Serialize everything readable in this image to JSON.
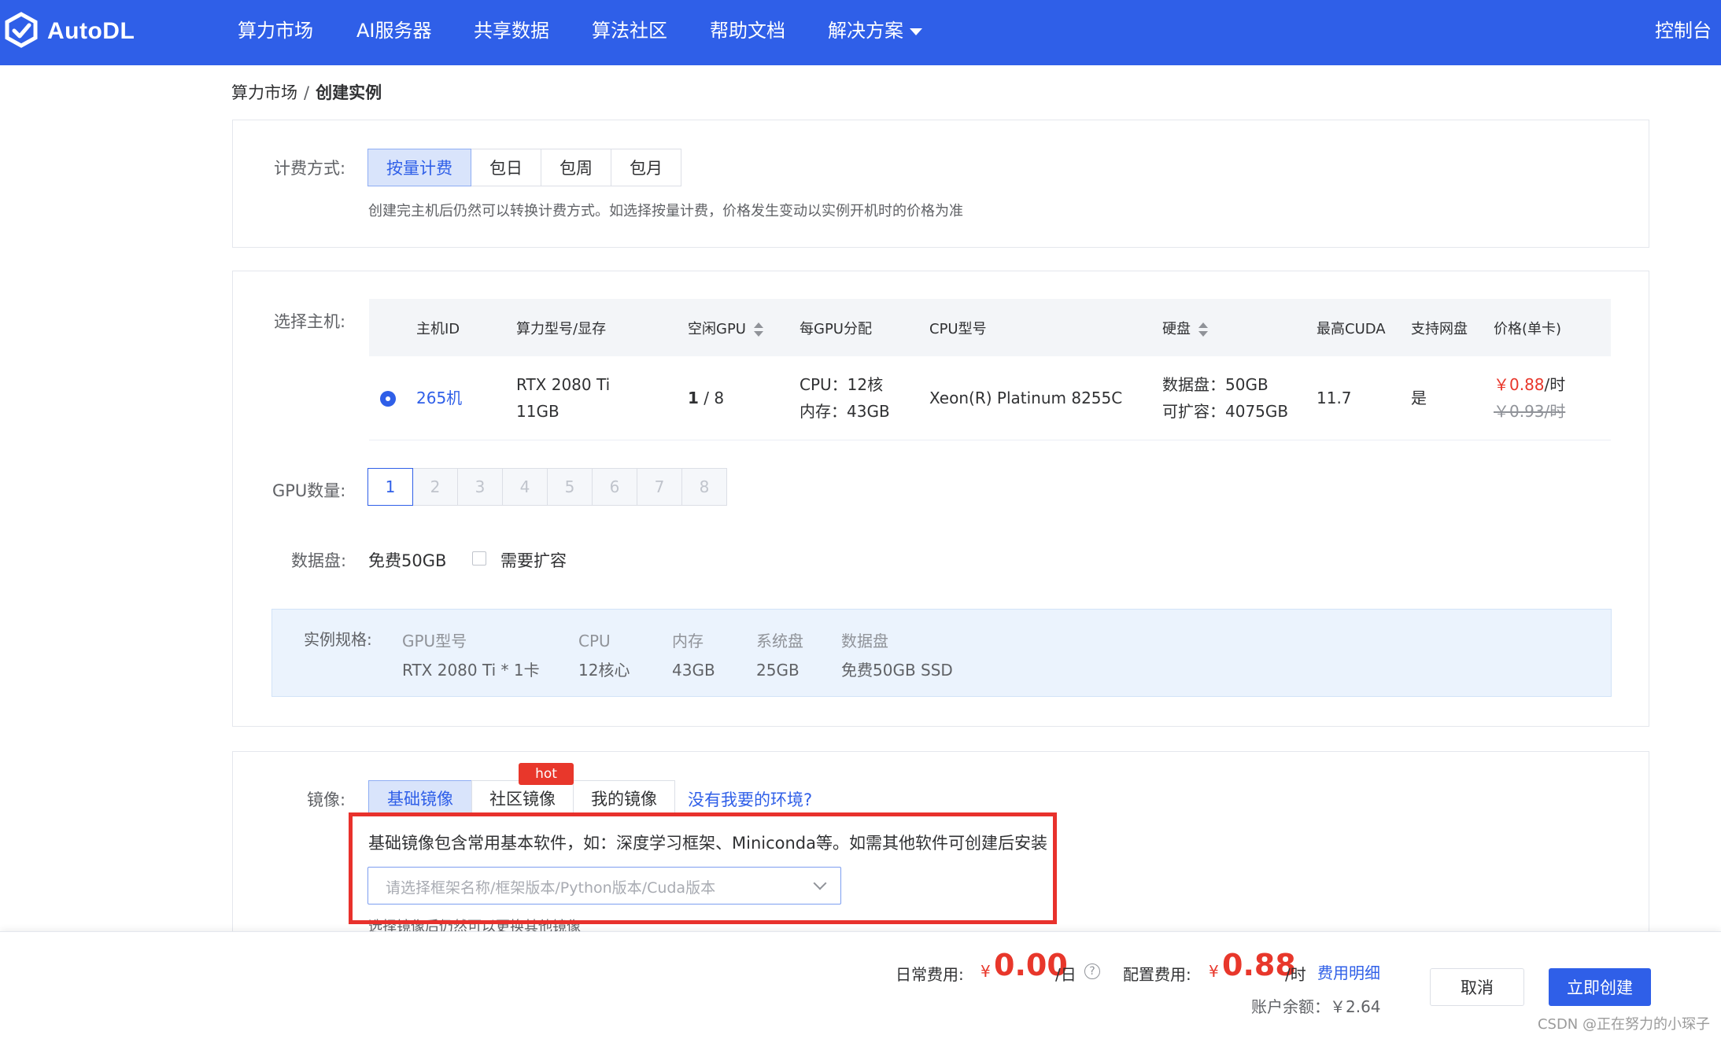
{
  "app": {
    "logo_text": "AutoDL",
    "nav": [
      "算力市场",
      "AI服务器",
      "共享数据",
      "算法社区",
      "帮助文档",
      "解决方案"
    ],
    "console": "控制台"
  },
  "breadcrumb": {
    "parent": "算力市场",
    "separator": "/",
    "current": "创建实例"
  },
  "billing": {
    "label": "计费方式:",
    "options": [
      "按量计费",
      "包日",
      "包周",
      "包月"
    ],
    "selected": "按量计费",
    "hint": "创建完主机后仍然可以转换计费方式。如选择按量计费，价格发生变动以实例开机时的价格为准"
  },
  "host": {
    "label": "选择主机:",
    "columns": [
      "主机ID",
      "算力型号/显存",
      "空闲GPU",
      "每GPU分配",
      "CPU型号",
      "硬盘",
      "最高CUDA",
      "支持网盘",
      "价格(单卡)"
    ],
    "row": {
      "id": "265机",
      "gpu_model": "RTX 2080 Ti",
      "gpu_mem": "11GB",
      "free_gpu": "1",
      "total_gpu": " / 8",
      "cpu_alloc": "CPU：12核",
      "mem_alloc": "内存：43GB",
      "cpu_model": "Xeon(R) Platinum 8255C",
      "disk": "数据盘：50GB",
      "disk_expand": "可扩容：4075GB",
      "cuda": "11.7",
      "netdisk": "是",
      "price": "￥0.88",
      "price_unit": "/时",
      "old_price": "￥0.93/时"
    }
  },
  "gpu_count": {
    "label": "GPU数量:",
    "options": [
      "1",
      "2",
      "3",
      "4",
      "5",
      "6",
      "7",
      "8"
    ],
    "selected": "1"
  },
  "data_disk": {
    "label": "数据盘:",
    "free": "免费50GB",
    "expand_label": "需要扩容"
  },
  "spec": {
    "label": "实例规格:",
    "gpu_k": "GPU型号",
    "gpu_v": "RTX 2080 Ti * 1卡",
    "cpu_k": "CPU",
    "cpu_v": "12核心",
    "mem_k": "内存",
    "mem_v": "43GB",
    "sys_k": "系统盘",
    "sys_v": "25GB",
    "data_k": "数据盘",
    "data_v": "免费50GB SSD"
  },
  "image": {
    "label": "镜像:",
    "tabs": [
      "基础镜像",
      "社区镜像",
      "我的镜像"
    ],
    "hot_badge": "hot",
    "no_env_link": "没有我要的环境?",
    "desc": "基础镜像包含常用基本软件，如：深度学习框架、Miniconda等。如需其他软件可创建后安装",
    "select_placeholder": "请选择框架名称/框架版本/Python版本/Cuda版本",
    "cut_text": "选择镜像后仍然可以更换其他镜像"
  },
  "footer": {
    "daily_label": "日常费用:",
    "daily_yen": "¥",
    "daily_value": "0.00",
    "daily_unit": "/日",
    "config_label": "配置费用:",
    "config_yen": "¥",
    "config_value": "0.88",
    "config_unit": "/时",
    "detail_link": "费用明细",
    "balance": "账户余额：￥2.64",
    "cancel": "取消",
    "create": "立即创建"
  },
  "watermark": "CSDN @正在努力的小琛子",
  "colors": {
    "primary": "#2f5fe8",
    "price_red": "#e8372b",
    "highlight_box": "#e8312c"
  }
}
